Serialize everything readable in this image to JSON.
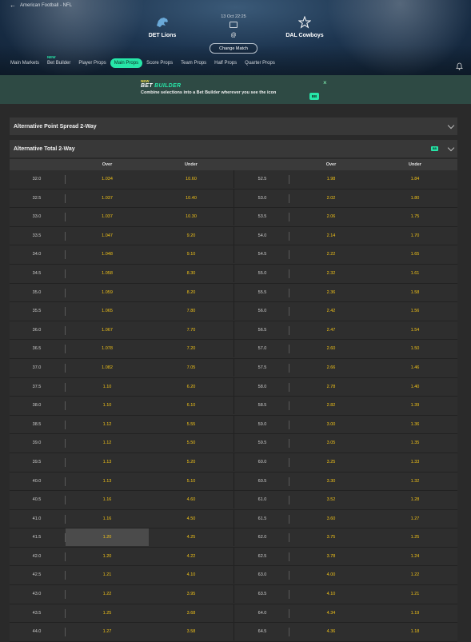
{
  "breadcrumb": "American Football - NFL",
  "match": {
    "home": "DET Lions",
    "away": "DAL Cowboys",
    "date": "13 Oct 22:25",
    "at": "@",
    "change_label": "Change Match"
  },
  "tabs": [
    {
      "label": "Main Markets",
      "active": false,
      "new": ""
    },
    {
      "label": "Bet Builder",
      "active": false,
      "new": "NEW"
    },
    {
      "label": "Player Props",
      "active": false,
      "new": ""
    },
    {
      "label": "Main Props",
      "active": true,
      "new": ""
    },
    {
      "label": "Score Props",
      "active": false,
      "new": ""
    },
    {
      "label": "Team Props",
      "active": false,
      "new": ""
    },
    {
      "label": "Half Props",
      "active": false,
      "new": ""
    },
    {
      "label": "Quarter Props",
      "active": false,
      "new": ""
    }
  ],
  "promo": {
    "new": "NEW",
    "title_a": "BET",
    "title_b": "BUILDER",
    "text": "Combine selections into a Bet Builder wherever you see the icon",
    "badge": "BB"
  },
  "sections": {
    "spread": "Alternative Point Spread 2-Way",
    "total": "Alternative Total 2-Way",
    "badge": "BB"
  },
  "columns": {
    "over": "Over",
    "under": "Under"
  },
  "rows": [
    {
      "l1": "32.0",
      "o1": "1.034",
      "u1": "10.60",
      "l2": "52.5",
      "o2": "1.98",
      "u2": "1.84"
    },
    {
      "l1": "32.5",
      "o1": "1.037",
      "u1": "10.40",
      "l2": "53.0",
      "o2": "2.02",
      "u2": "1.80"
    },
    {
      "l1": "33.0",
      "o1": "1.037",
      "u1": "10.30",
      "l2": "53.5",
      "o2": "2.06",
      "u2": "1.75"
    },
    {
      "l1": "33.5",
      "o1": "1.047",
      "u1": "9.20",
      "l2": "54.0",
      "o2": "2.14",
      "u2": "1.70"
    },
    {
      "l1": "34.0",
      "o1": "1.048",
      "u1": "9.10",
      "l2": "54.5",
      "o2": "2.22",
      "u2": "1.65"
    },
    {
      "l1": "34.5",
      "o1": "1.058",
      "u1": "8.30",
      "l2": "55.0",
      "o2": "2.32",
      "u2": "1.61"
    },
    {
      "l1": "35.0",
      "o1": "1.059",
      "u1": "8.20",
      "l2": "55.5",
      "o2": "2.36",
      "u2": "1.58"
    },
    {
      "l1": "35.5",
      "o1": "1.065",
      "u1": "7.80",
      "l2": "56.0",
      "o2": "2.42",
      "u2": "1.56"
    },
    {
      "l1": "36.0",
      "o1": "1.067",
      "u1": "7.70",
      "l2": "56.5",
      "o2": "2.47",
      "u2": "1.54"
    },
    {
      "l1": "36.5",
      "o1": "1.078",
      "u1": "7.20",
      "l2": "57.0",
      "o2": "2.60",
      "u2": "1.50"
    },
    {
      "l1": "37.0",
      "o1": "1.082",
      "u1": "7.05",
      "l2": "57.5",
      "o2": "2.66",
      "u2": "1.46"
    },
    {
      "l1": "37.5",
      "o1": "1.10",
      "u1": "6.20",
      "l2": "58.0",
      "o2": "2.78",
      "u2": "1.40"
    },
    {
      "l1": "38.0",
      "o1": "1.10",
      "u1": "6.10",
      "l2": "58.5",
      "o2": "2.82",
      "u2": "1.39"
    },
    {
      "l1": "38.5",
      "o1": "1.12",
      "u1": "5.55",
      "l2": "59.0",
      "o2": "3.00",
      "u2": "1.36"
    },
    {
      "l1": "39.0",
      "o1": "1.12",
      "u1": "5.50",
      "l2": "59.5",
      "o2": "3.05",
      "u2": "1.35"
    },
    {
      "l1": "39.5",
      "o1": "1.13",
      "u1": "5.20",
      "l2": "60.0",
      "o2": "3.25",
      "u2": "1.33"
    },
    {
      "l1": "40.0",
      "o1": "1.13",
      "u1": "5.10",
      "l2": "60.5",
      "o2": "3.30",
      "u2": "1.32"
    },
    {
      "l1": "40.5",
      "o1": "1.16",
      "u1": "4.60",
      "l2": "61.0",
      "o2": "3.52",
      "u2": "1.28"
    },
    {
      "l1": "41.0",
      "o1": "1.16",
      "u1": "4.50",
      "l2": "61.5",
      "o2": "3.60",
      "u2": "1.27"
    },
    {
      "l1": "41.5",
      "o1": "1.20",
      "u1": "4.25",
      "l2": "62.0",
      "o2": "3.75",
      "u2": "1.25",
      "hl": true
    },
    {
      "l1": "42.0",
      "o1": "1.20",
      "u1": "4.22",
      "l2": "62.5",
      "o2": "3.78",
      "u2": "1.24"
    },
    {
      "l1": "42.5",
      "o1": "1.21",
      "u1": "4.10",
      "l2": "63.0",
      "o2": "4.00",
      "u2": "1.22"
    },
    {
      "l1": "43.0",
      "o1": "1.22",
      "u1": "3.95",
      "l2": "63.5",
      "o2": "4.10",
      "u2": "1.21"
    },
    {
      "l1": "43.5",
      "o1": "1.25",
      "u1": "3.68",
      "l2": "64.0",
      "o2": "4.34",
      "u2": "1.19"
    },
    {
      "l1": "44.0",
      "o1": "1.27",
      "u1": "3.58",
      "l2": "64.5",
      "o2": "4.36",
      "u2": "1.18"
    }
  ],
  "colors": {
    "accent": "#27e6a8",
    "odds": "#f2c318"
  },
  "icons": {
    "back": "arrow-left-icon",
    "bell": "bell-icon",
    "close": "close-icon"
  }
}
